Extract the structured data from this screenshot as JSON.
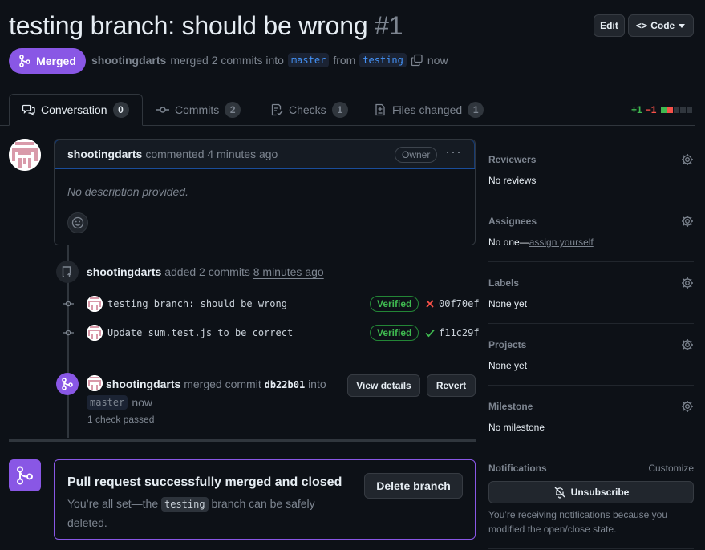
{
  "header": {
    "title": "testing branch: should be wrong",
    "number": "#1",
    "edit_label": "Edit",
    "code_label": "Code"
  },
  "status": {
    "badge": "Merged",
    "author": "shootingdarts",
    "action": "merged 2 commits into",
    "base_branch": "master",
    "from_word": "from",
    "head_branch": "testing",
    "time": "now"
  },
  "tabs": [
    {
      "label": "Conversation",
      "count": "0"
    },
    {
      "label": "Commits",
      "count": "2"
    },
    {
      "label": "Checks",
      "count": "1"
    },
    {
      "label": "Files changed",
      "count": "1"
    }
  ],
  "diffstat": {
    "additions": "+1",
    "deletions": "−1"
  },
  "comment": {
    "author": "shootingdarts",
    "when": "commented 4 minutes ago",
    "role": "Owner",
    "body": "No description provided."
  },
  "commits_event": {
    "author": "shootingdarts",
    "action": "added 2 commits",
    "time": "8 minutes ago",
    "commits": [
      {
        "message": "testing branch: should be wrong",
        "verified": "Verified",
        "status": "failed",
        "sha": "00f70ef"
      },
      {
        "message": "Update sum.test.js to be correct",
        "verified": "Verified",
        "status": "passed",
        "sha": "f11c29f"
      }
    ]
  },
  "merge_event": {
    "author": "shootingdarts",
    "action": "merged commit",
    "sha": "db22b01",
    "into_word": "into",
    "branch": "master",
    "time": "now",
    "checks": "1 check passed",
    "view_details": "View details",
    "revert": "Revert"
  },
  "merged_box": {
    "title": "Pull request successfully merged and closed",
    "desc_before": "You’re all set—the",
    "branch": "testing",
    "desc_after": "branch can be safely deleted.",
    "delete_label": "Delete branch"
  },
  "sidebar": {
    "reviewers": {
      "heading": "Reviewers",
      "value": "No reviews"
    },
    "assignees": {
      "heading": "Assignees",
      "value": "No one—",
      "link": "assign yourself"
    },
    "labels": {
      "heading": "Labels",
      "value": "None yet"
    },
    "projects": {
      "heading": "Projects",
      "value": "None yet"
    },
    "milestone": {
      "heading": "Milestone",
      "value": "No milestone"
    },
    "notifications": {
      "heading": "Notifications",
      "customize": "Customize",
      "unsubscribe": "Unsubscribe",
      "note": "You’re receiving notifications because you modified the open/close state."
    }
  },
  "colors": {
    "merged": "#8957e5",
    "success": "#3fb950",
    "danger": "#f85149",
    "link": "#4493f8"
  }
}
